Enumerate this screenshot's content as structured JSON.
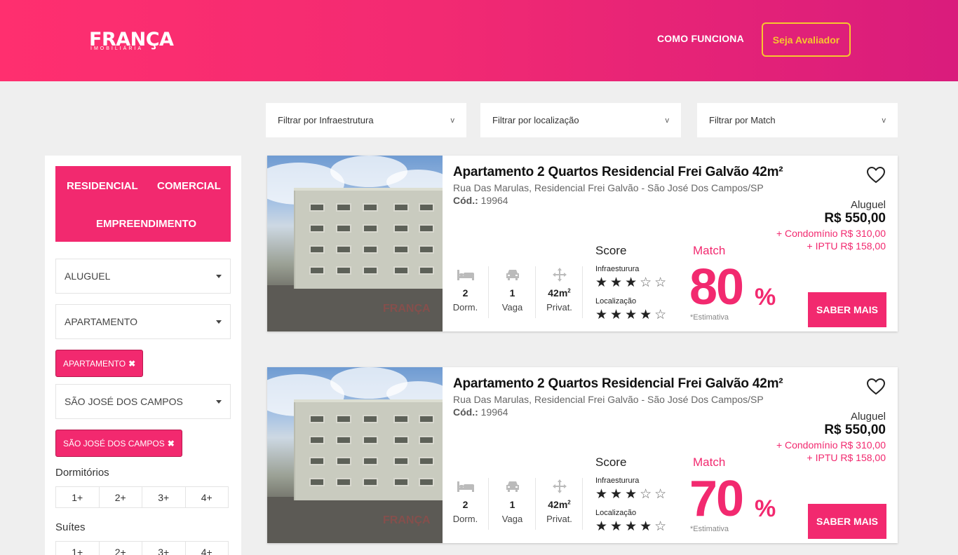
{
  "header": {
    "logo_main": "FRANÇA",
    "logo_sub": "IMOBILIÁRIA",
    "nav_how": "COMO FUNCIONA",
    "nav_cta": "Seja Avaliador",
    "cta_color": "#f7c62f",
    "brand_color": "#f2296f"
  },
  "filters": [
    {
      "label": "Filtrar por Infraestrutura",
      "chevron": "v"
    },
    {
      "label": "Filtrar por localização",
      "chevron": "v"
    },
    {
      "label": "Filtrar por Match",
      "chevron": "v"
    }
  ],
  "sidebar": {
    "types": [
      "RESIDENCIAL",
      "COMERCIAL",
      "EMPREENDIMENTO"
    ],
    "select_mode": "ALUGUEL",
    "select_property": "APARTAMENTO",
    "tag_property": "APARTAMENTO",
    "select_city": "SÃO JOSÉ DOS CAMPOS",
    "tag_city": "SÃO JOSÉ DOS CAMPOS",
    "tag_remove": "✖",
    "bedrooms_label": "Dormitórios",
    "bedrooms_options": [
      "1+",
      "2+",
      "3+",
      "4+"
    ],
    "suites_label": "Suítes",
    "suites_options": [
      "1+",
      "2+",
      "3+",
      "4+"
    ]
  },
  "listings": [
    {
      "title": "Apartamento 2 Quartos Residencial Frei Galvão 42m²",
      "address": "Rua Das Marulas, Residencial Frei Galvão - São José Dos Campos/SP",
      "code_label": "Cód.:",
      "code": "19964",
      "price_label": "Aluguel",
      "price": "R$ 550,00",
      "condo": "+ Condomínio R$ 310,00",
      "iptu": "+ IPTU R$ 158,00",
      "bedrooms": "2",
      "bedrooms_label": "Dorm.",
      "parking": "1",
      "parking_label": "Vaga",
      "area": "42m",
      "area_unit": "2",
      "area_label": "Privat.",
      "score_label": "Score",
      "infra_label": "Infraesturura",
      "infra_stars": 3,
      "location_label": "Localização",
      "location_stars": 4,
      "match_label": "Match",
      "match_value": "80",
      "match_unit": "%",
      "estimate_label": "*Estimativa",
      "cta": "SABER MAIS",
      "watermark": "FRANÇA"
    },
    {
      "title": "Apartamento 2 Quartos Residencial Frei Galvão 42m²",
      "address": "Rua Das Marulas, Residencial Frei Galvão - São José Dos Campos/SP",
      "code_label": "Cód.:",
      "code": "19964",
      "price_label": "Aluguel",
      "price": "R$ 550,00",
      "condo": "+ Condomínio R$ 310,00",
      "iptu": "+ IPTU R$ 158,00",
      "bedrooms": "2",
      "bedrooms_label": "Dorm.",
      "parking": "1",
      "parking_label": "Vaga",
      "area": "42m",
      "area_unit": "2",
      "area_label": "Privat.",
      "score_label": "Score",
      "infra_label": "Infraesturura",
      "infra_stars": 3,
      "location_label": "Localização",
      "location_stars": 4,
      "match_label": "Match",
      "match_value": "70",
      "match_unit": "%",
      "estimate_label": "*Estimativa",
      "cta": "SABER MAIS",
      "watermark": "FRANÇA"
    }
  ]
}
